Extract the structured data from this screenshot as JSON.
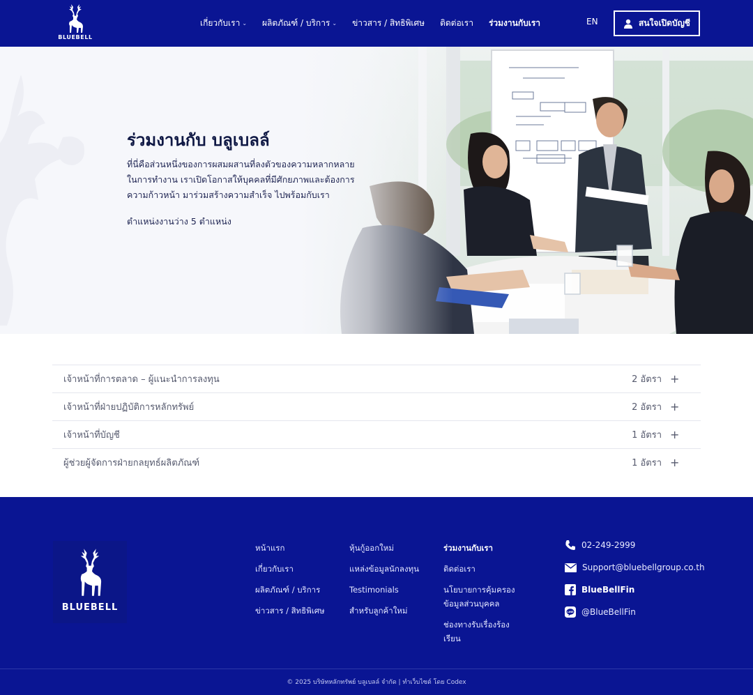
{
  "header": {
    "logo_text": "BLUEBELL",
    "nav": [
      {
        "label": "เกี่ยวกับเรา",
        "dropdown": true
      },
      {
        "label": "ผลิตภัณฑ์ / บริการ",
        "dropdown": true
      },
      {
        "label": "ข่าวสาร / สิทธิพิเศษ",
        "dropdown": false
      },
      {
        "label": "ติดต่อเรา",
        "dropdown": false
      },
      {
        "label": "ร่วมงานกับเรา",
        "dropdown": false,
        "active": true
      }
    ],
    "language": "EN",
    "open_account_label": "สนใจเปิดบัญชี"
  },
  "hero": {
    "title": "ร่วมงานกับ บลูเบลล์",
    "description": "ที่นี่คือส่วนหนึ่งของการผสมผสานที่ลงตัวของความหลากหลายในการทำงาน เราเปิดโอกาสให้บุคคลที่มีศักยภาพและต้องการความก้าวหน้า มาร่วมสร้างความสำเร็จ ไปพร้อมกับเรา",
    "open_positions": "ตำแหน่งงานว่าง 5 ตำแหน่ง"
  },
  "jobs": [
    {
      "title": "เจ้าหน้าที่การตลาด – ผู้แนะนำการลงทุน",
      "count": "2 อัตรา"
    },
    {
      "title": "เจ้าหน้าที่ฝ่ายปฏิบัติการหลักทรัพย์",
      "count": "2 อัตรา"
    },
    {
      "title": "เจ้าหน้าที่บัญชี",
      "count": "1 อัตรา"
    },
    {
      "title": "ผู้ช่วยผู้จัดการฝ่ายกลยุทธ์ผลิตภัณฑ์",
      "count": "1 อัตรา"
    }
  ],
  "footer": {
    "logo_text": "BLUEBELL",
    "col1": [
      "หน้าแรก",
      "เกี่ยวกับเรา",
      "ผลิตภัณฑ์ / บริการ",
      "ข่าวสาร / สิทธิพิเศษ"
    ],
    "col2": [
      "หุ้นกู้ออกใหม่",
      "แหล่งข้อมูลนักลงทุน",
      "Testimonials",
      "สำหรับลูกค้าใหม่"
    ],
    "col3": [
      "ร่วมงานกับเรา",
      "ติดต่อเรา",
      "นโยบายการคุ้มครองข้อมูลส่วนบุคคล",
      "ช่องทางรับเรื่องร้องเรียน"
    ],
    "contact": {
      "phone": "02-249-2999",
      "email": "Support@bluebellgroup.co.th",
      "facebook": "BlueBellFin",
      "line": "@BlueBellFin"
    },
    "copyright": "© 2025 บริษัทหลักทรัพย์ บลูเบลล์ จำกัด | ทำเว็บไซต์ โดย Codex"
  },
  "colors": {
    "brand_navy": "#0a1593",
    "hero_bg": "#f6f7fb",
    "text_dark": "#0f1844",
    "row_text": "#565a6e"
  }
}
